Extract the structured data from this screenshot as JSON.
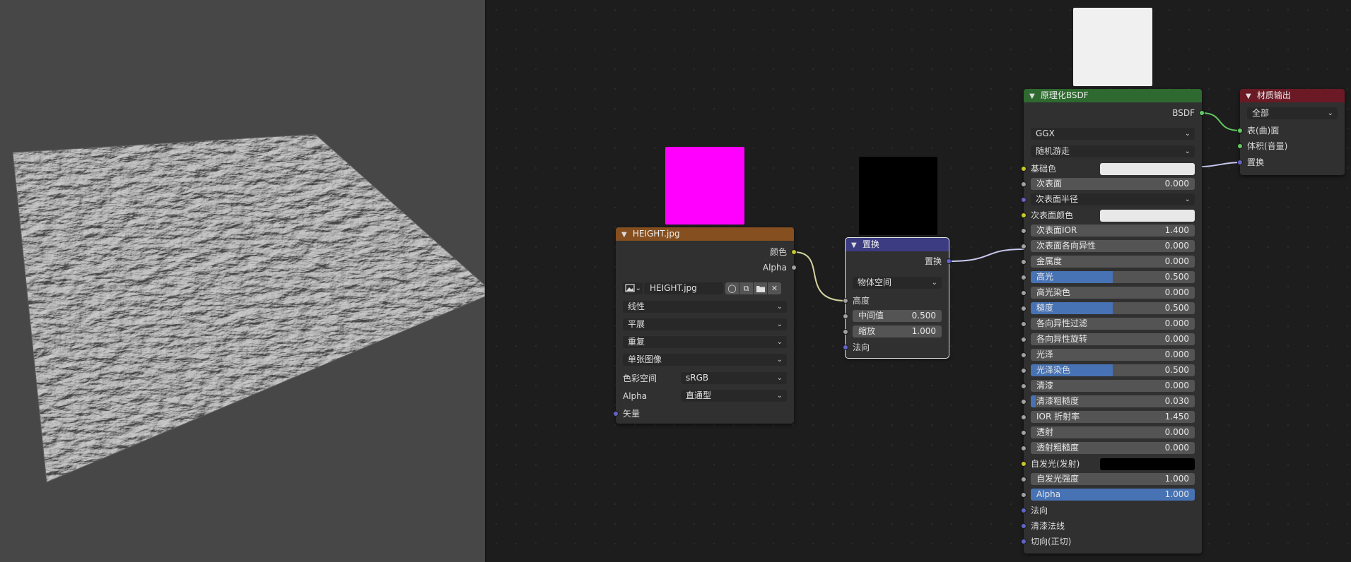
{
  "colors": {
    "image_header": "#854f1f",
    "displacement_header": "#3c3c83",
    "bsdf_header": "#2e6a2f",
    "output_header": "#6b1a25",
    "slider_fill": "#4772b3",
    "color_socket": "#c7c729",
    "float_socket": "#a1a1a1",
    "vector_socket": "#6363c7",
    "shader_socket": "#63c763"
  },
  "previews": {
    "image_preview_color": "#ff00ff",
    "displacement_preview_color": "#000000",
    "bsdf_preview_color": "#f0f0f0"
  },
  "image_node": {
    "title": "HEIGHT.jpg",
    "outputs": [
      "颜色",
      "Alpha"
    ],
    "image_name": "HEIGHT.jpg",
    "interpolation": "线性",
    "projection": "平展",
    "extension": "重复",
    "source": "单张图像",
    "colorspace_label": "色彩空间",
    "colorspace_value": "sRGB",
    "alpha_label": "Alpha",
    "alpha_value": "直通型",
    "vector_input": "矢量",
    "icons": [
      "image-icon",
      "fake-user-shield-icon",
      "duplicate-icon",
      "open-folder-icon",
      "unlink-x-icon"
    ]
  },
  "displacement_node": {
    "title": "置换",
    "output": "置换",
    "space": "物体空间",
    "height_label": "高度",
    "midlevel_label": "中间值",
    "midlevel_value": "0.500",
    "scale_label": "缩放",
    "scale_value": "1.000",
    "normal_label": "法向"
  },
  "bsdf_node": {
    "title": "原理化BSDF",
    "output": "BSDF",
    "distribution": "GGX",
    "subsurface_method": "随机游走",
    "base_color_label": "基础色",
    "base_color": "#e8e8e8",
    "subsurface_label": "次表面",
    "subsurface_value": "0.000",
    "subsurface_radius_label": "次表面半径",
    "subsurface_color_label": "次表面颜色",
    "subsurface_color": "#e8e8e8",
    "params": [
      {
        "label": "次表面IOR",
        "value": "1.400",
        "fill": 0
      },
      {
        "label": "次表面各向异性",
        "value": "0.000",
        "fill": 0
      },
      {
        "label": "金属度",
        "value": "0.000",
        "fill": 0
      },
      {
        "label": "高光",
        "value": "0.500",
        "fill": 0.5
      },
      {
        "label": "高光染色",
        "value": "0.000",
        "fill": 0
      },
      {
        "label": "糙度",
        "value": "0.500",
        "fill": 0.5
      },
      {
        "label": "各向异性过滤",
        "value": "0.000",
        "fill": 0
      },
      {
        "label": "各向异性旋转",
        "value": "0.000",
        "fill": 0
      },
      {
        "label": "光泽",
        "value": "0.000",
        "fill": 0
      },
      {
        "label": "光泽染色",
        "value": "0.500",
        "fill": 0.5
      },
      {
        "label": "清漆",
        "value": "0.000",
        "fill": 0
      },
      {
        "label": "清漆粗糙度",
        "value": "0.030",
        "fill": 0.03
      },
      {
        "label": "IOR 折射率",
        "value": "1.450",
        "fill": 0
      },
      {
        "label": "透射",
        "value": "0.000",
        "fill": 0
      },
      {
        "label": "透射粗糙度",
        "value": "0.000",
        "fill": 0
      }
    ],
    "emission_label": "自发光(发射)",
    "emission_color": "#000000",
    "emission_strength_label": "自发光强度",
    "emission_strength_value": "1.000",
    "alpha_label": "Alpha",
    "alpha_value": "1.000",
    "alpha_fill": 1,
    "normal_label": "法向",
    "clearcoat_normal_label": "清漆法线",
    "tangent_label": "切向(正切)"
  },
  "output_node": {
    "title": "材质输出",
    "target": "全部",
    "inputs": [
      "表(曲)面",
      "体积(音量)",
      "置换"
    ]
  }
}
